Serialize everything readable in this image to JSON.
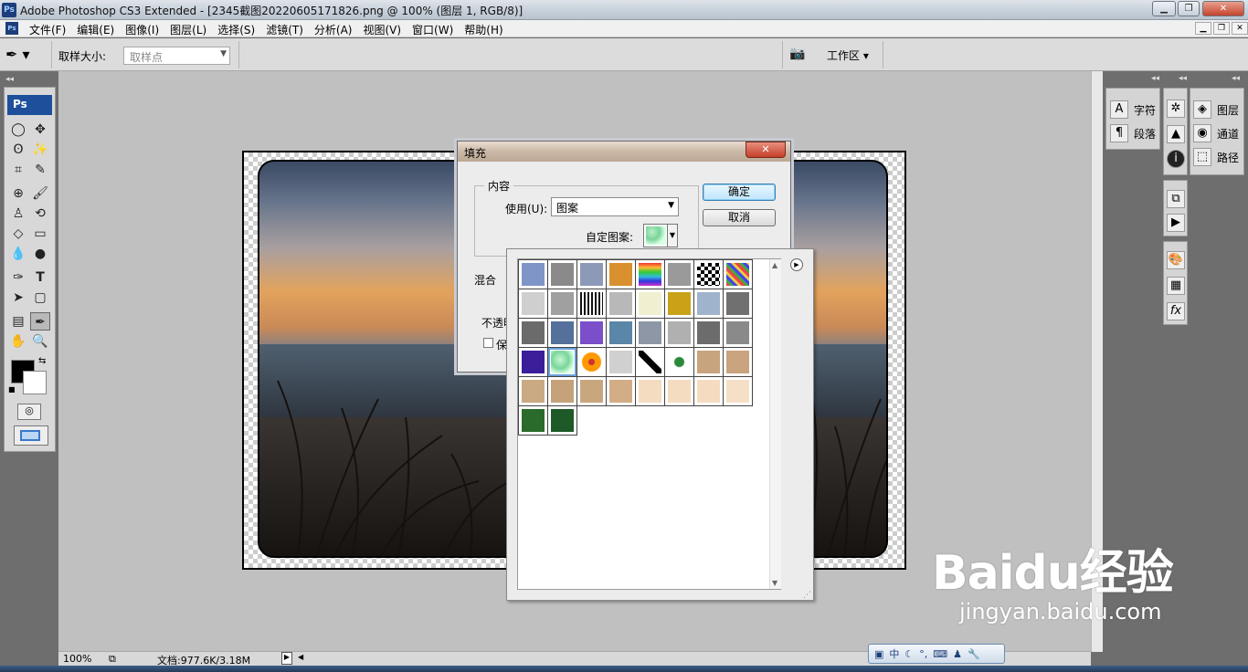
{
  "app": {
    "title": "Adobe Photoshop CS3 Extended - [2345截图20220605171826.png @ 100% (图层 1, RGB/8)]",
    "logo": "Ps"
  },
  "menu": [
    "文件(F)",
    "编辑(E)",
    "图像(I)",
    "图层(L)",
    "选择(S)",
    "滤镜(T)",
    "分析(A)",
    "视图(V)",
    "窗口(W)",
    "帮助(H)"
  ],
  "options": {
    "sample_size_label": "取样大小:",
    "sample_size_value": "取样点",
    "workspace_label": "工作区 ▾"
  },
  "toolbox": {
    "logo": "Ps"
  },
  "panels": {
    "group1": [
      {
        "icon": "A",
        "label": "字符"
      },
      {
        "icon": "¶",
        "label": "段落"
      }
    ],
    "group2": [
      {
        "icon": "layers-icon",
        "label": "图层"
      },
      {
        "icon": "channels-icon",
        "label": "通道"
      },
      {
        "icon": "paths-icon",
        "label": "路径"
      }
    ]
  },
  "fill_dialog": {
    "title": "填充",
    "close": "✕",
    "contents_group": "内容",
    "use_label": "使用(U):",
    "use_value": "图案",
    "custom_pattern_label": "自定图案:",
    "blending_group": "混合",
    "opacity_label": "不透明",
    "preserve_label": "保",
    "ok_button": "确定",
    "cancel_button": "取消"
  },
  "pattern_picker": {
    "patterns": [
      "#7f95c7",
      "#8a8a8a",
      "#8c9ab8",
      "#d9902e",
      "rainbow",
      "#9a9a9a",
      "checker",
      "multicolor",
      "#cfcfcf",
      "#a0a0a0",
      "stripes",
      "#b8b8b8",
      "#f0f0d0",
      "#c9a218",
      "#9fb3cc",
      "#707070",
      "#6b6b6b",
      "#55709a",
      "#7a4fc9",
      "#5a86a8",
      "#8d97a6",
      "#b0b0b0",
      "#6c6c6c",
      "#8a8a8a",
      "#3a1e9a",
      "green-selected",
      "orange-flower",
      "#d0d0d0",
      "diagonal",
      "green-leaf",
      "#c8a47e",
      "#c9a47e",
      "#c9aa83",
      "#c6a27a",
      "#c9a77e",
      "#d2ad85",
      "#f4dcc0",
      "#f4dcc0",
      "#f5dcc0",
      "#f5e0c7",
      "#2a6a2a",
      "#1e5a28"
    ]
  },
  "status": {
    "zoom": "100%",
    "doc": "文档:977.6K/3.18M"
  },
  "ime": {
    "label": "中"
  },
  "watermark": {
    "brand": "Baidu经验",
    "url": "jingyan.baidu.com"
  }
}
